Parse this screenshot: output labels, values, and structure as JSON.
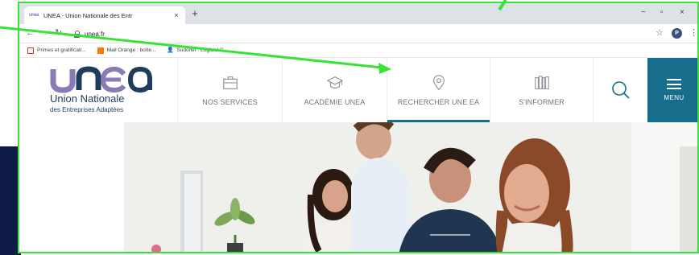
{
  "browser": {
    "tab_title": "UNEA - Union Nationale des Entr",
    "tab_favicon": "unea",
    "tab_close": "×",
    "new_tab": "+",
    "window_controls": [
      "−",
      "▫",
      "×"
    ],
    "url": "unea.fr",
    "profile_initial": "P",
    "colors": {
      "highlight": "#36e336",
      "tabstrip": "#dee1e6"
    }
  },
  "bookmarks": [
    {
      "label": "Primes et gratificati...",
      "icon": "document-icon"
    },
    {
      "label": "Mail Orange : boîte...",
      "icon": "orange-square-icon"
    },
    {
      "label": "Sudonet : Logiciel G...",
      "icon": "user-icon"
    }
  ],
  "site": {
    "logo": {
      "mark": "unea",
      "name": "Union Nationale",
      "sub": "des Entreprises Adaptées"
    },
    "nav": [
      {
        "label": "NOS SERVICES",
        "icon": "briefcase-icon",
        "active": false
      },
      {
        "label": "ACADÉMIE UNEA",
        "icon": "graduation-cap-icon",
        "active": false
      },
      {
        "label": "RECHERCHER UNE EA",
        "icon": "location-pin-icon",
        "active": true
      },
      {
        "label": "S'INFORMER",
        "icon": "books-icon",
        "active": false
      }
    ],
    "search_icon": "search-icon",
    "menu_label": "MENU",
    "colors": {
      "accent": "#166e8c",
      "text": "#6b7480",
      "logo_light": "#8a7bb5",
      "logo_dark": "#1f3c5a"
    }
  },
  "annotation": {
    "arrow_color": "#36e336"
  }
}
